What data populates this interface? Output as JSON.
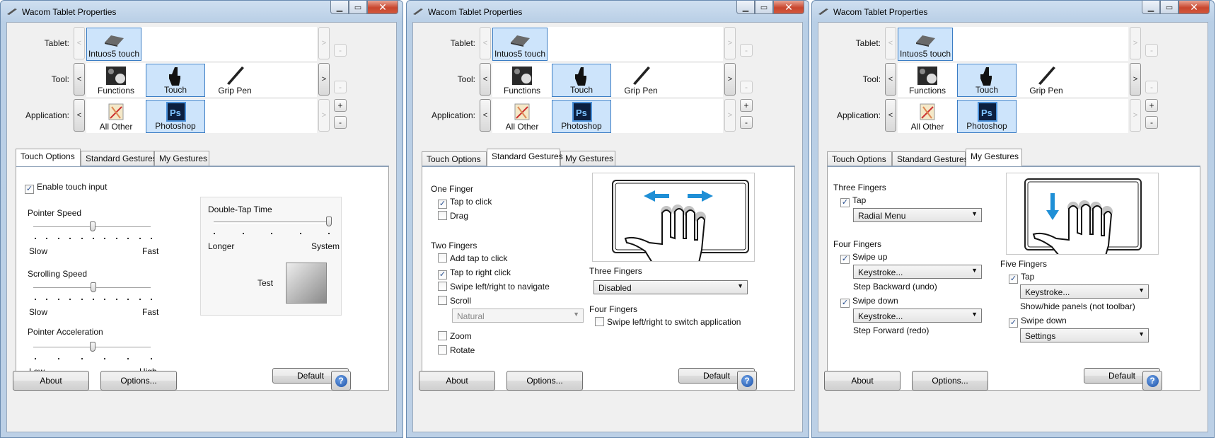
{
  "windows": [
    {
      "title": "Wacom Tablet Properties",
      "row_labels": {
        "tablet": "Tablet:",
        "tool": "Tool:",
        "application": "Application:"
      },
      "tablet_item": "Intuos5 touch",
      "tools": [
        "Functions",
        "Touch",
        "Grip Pen"
      ],
      "apps": [
        "All Other",
        "Photoshop"
      ],
      "tabs": [
        "Touch Options",
        "Standard Gestures",
        "My Gestures"
      ],
      "active_tab": 0,
      "touch_options": {
        "enable_touch": "Enable touch input",
        "pointer_speed": "Pointer Speed",
        "slow1": "Slow",
        "fast1": "Fast",
        "scrolling_speed": "Scrolling Speed",
        "slow2": "Slow",
        "fast2": "Fast",
        "pointer_accel": "Pointer Acceleration",
        "low": "Low",
        "high": "High",
        "double_tap": "Double-Tap Time",
        "longer": "Longer",
        "system": "System",
        "test": "Test",
        "pointer_speed_value": 0.5,
        "scrolling_speed_value": 0.5,
        "pointer_accel_value": 0.5,
        "double_tap_value": 1.0
      },
      "default_label": "Default",
      "about_label": "About",
      "options_label": "Options..."
    },
    {
      "title": "Wacom Tablet Properties",
      "row_labels": {
        "tablet": "Tablet:",
        "tool": "Tool:",
        "application": "Application:"
      },
      "tablet_item": "Intuos5 touch",
      "tools": [
        "Functions",
        "Touch",
        "Grip Pen"
      ],
      "apps": [
        "All Other",
        "Photoshop"
      ],
      "tabs": [
        "Touch Options",
        "Standard Gestures",
        "My Gestures"
      ],
      "active_tab": 1,
      "standard_gestures": {
        "one_finger": "One Finger",
        "tap_to_click": "Tap to click",
        "drag": "Drag",
        "two_fingers": "Two Fingers",
        "add_tap_to_click": "Add tap to click",
        "tap_to_right_click": "Tap to right click",
        "swipe_navigate": "Swipe left/right to navigate",
        "scroll": "Scroll",
        "scroll_mode": "Natural",
        "zoom": "Zoom",
        "rotate": "Rotate",
        "three_fingers": "Three Fingers",
        "three_fingers_value": "Disabled",
        "four_fingers": "Four Fingers",
        "swipe_switch_app": "Swipe left/right to switch application"
      },
      "default_label": "Default",
      "about_label": "About",
      "options_label": "Options..."
    },
    {
      "title": "Wacom Tablet Properties",
      "row_labels": {
        "tablet": "Tablet:",
        "tool": "Tool:",
        "application": "Application:"
      },
      "tablet_item": "Intuos5 touch",
      "tools": [
        "Functions",
        "Touch",
        "Grip Pen"
      ],
      "apps": [
        "All Other",
        "Photoshop"
      ],
      "tabs": [
        "Touch Options",
        "Standard Gestures",
        "My Gestures"
      ],
      "active_tab": 2,
      "my_gestures": {
        "three_fingers": "Three Fingers",
        "tap": "Tap",
        "tap_action": "Radial Menu",
        "four_fingers": "Four Fingers",
        "swipe_up": "Swipe up",
        "swipe_up_action": "Keystroke...",
        "swipe_up_desc": "Step Backward (undo)",
        "swipe_down": "Swipe down",
        "swipe_down_action": "Keystroke...",
        "swipe_down_desc": "Step Forward (redo)",
        "five_fingers": "Five Fingers",
        "five_tap": "Tap",
        "five_tap_action": "Keystroke...",
        "five_tap_desc": "Show/hide panels (not toolbar)",
        "five_swipe_down": "Swipe down",
        "five_swipe_down_action": "Settings"
      },
      "default_label": "Default",
      "about_label": "About",
      "options_label": "Options..."
    }
  ],
  "colors": {
    "selection": "#cde4fb",
    "selection_border": "#3b7dc4",
    "arrow_blue": "#1f8fd6",
    "window_frame": "#bcd0e6"
  }
}
